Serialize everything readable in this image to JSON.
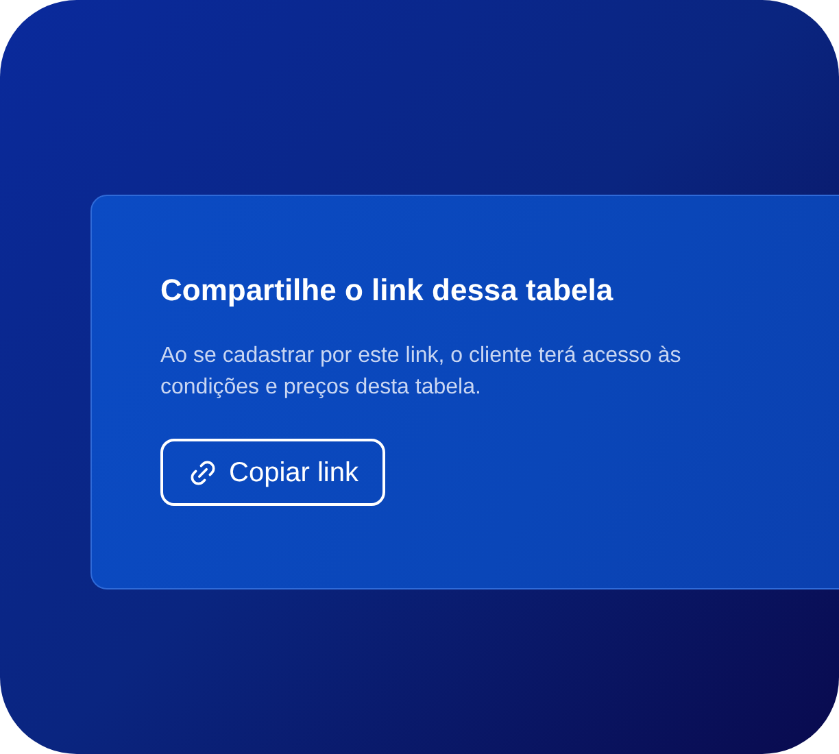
{
  "card": {
    "title": "Compartilhe o link dessa tabela",
    "description": "Ao se cadastrar por este link, o cliente terá acesso às condições e preços desta tabela.",
    "button": "Copiar link"
  }
}
